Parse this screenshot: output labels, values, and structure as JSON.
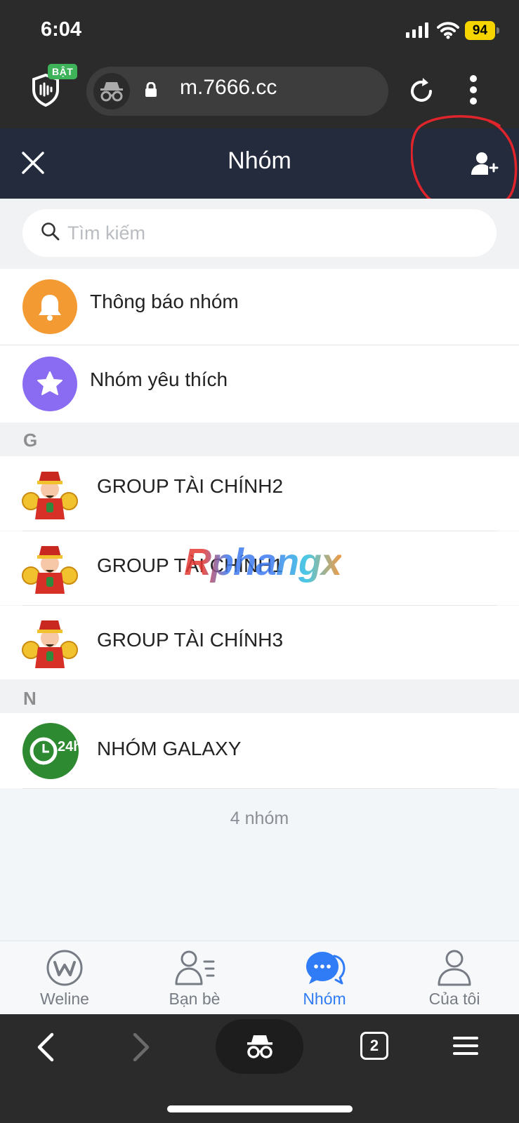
{
  "status_bar": {
    "time": "6:04",
    "battery": "94"
  },
  "browser": {
    "shield_badge": "BẬT",
    "url": "m.7666.cc",
    "tab_count": "2"
  },
  "header": {
    "title": "Nhóm"
  },
  "search": {
    "placeholder": "Tìm kiếm"
  },
  "quick_items": [
    {
      "label": "Thông báo nhóm",
      "icon": "bell-icon",
      "color": "#f39a32"
    },
    {
      "label": "Nhóm yêu thích",
      "icon": "star-icon",
      "color": "#8a6cf3"
    }
  ],
  "sections": [
    {
      "letter": "G",
      "groups": [
        {
          "name": "GROUP TÀI CHÍNH2",
          "avatar": "god-of-wealth-avatar"
        },
        {
          "name": "GROUP TÀI CHÍNH1",
          "avatar": "god-of-wealth-avatar"
        },
        {
          "name": "GROUP TÀI CHÍNH3",
          "avatar": "god-of-wealth-avatar"
        }
      ]
    },
    {
      "letter": "N",
      "groups": [
        {
          "name": "NHÓM GALAXY",
          "avatar": "clock-24h-avatar"
        }
      ]
    }
  ],
  "group_count": "4 nhóm",
  "watermark": "Rphangx",
  "tabs": [
    {
      "label": "Weline",
      "icon": "weline-icon",
      "active": false
    },
    {
      "label": "Bạn bè",
      "icon": "friends-icon",
      "active": false
    },
    {
      "label": "Nhóm",
      "icon": "chat-bubbles-icon",
      "active": true
    },
    {
      "label": "Của tôi",
      "icon": "profile-icon",
      "active": false
    }
  ],
  "colors": {
    "header_bg": "#232b3d",
    "active_tab": "#2f7cf6",
    "inactive_tab": "#777c84",
    "annotation": "#e0242b",
    "battery": "#f5d400"
  }
}
